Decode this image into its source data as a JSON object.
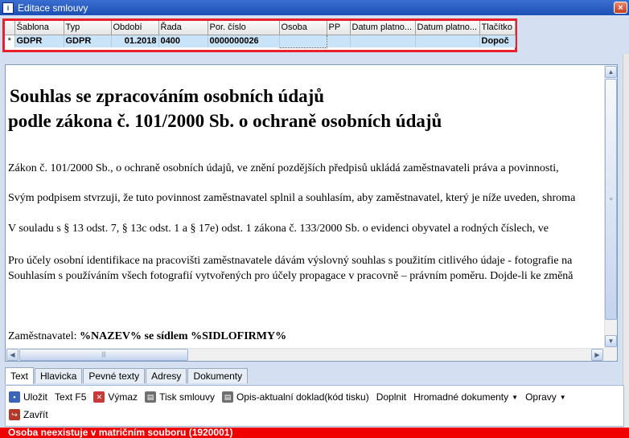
{
  "window": {
    "title": "Editace smlouvy",
    "close": "×"
  },
  "grid": {
    "columns": [
      "Šablona",
      "Typ",
      "Období",
      "Řada",
      "Por. číslo",
      "Osoba",
      "PP",
      "Datum platno...",
      "Datum platno...",
      "Tlačítko"
    ],
    "row": {
      "indicator": "*",
      "sablona": "GDPR",
      "typ": "GDPR",
      "obdobi": "01.2018",
      "rada": "0400",
      "por_cislo": "0000000026",
      "osoba": "",
      "pp": "",
      "datum1": "",
      "datum2": "",
      "tlacitko": "Dopoč"
    }
  },
  "document": {
    "heading1": "Souhlas se zpracováním osobních údajů",
    "heading2": "podle zákona č. 101/2000 Sb. o ochraně osobních údajů",
    "p1": "Zákon č. 101/2000 Sb., o ochraně osobních údajů, ve znění pozdějších předpisů ukládá zaměstnavateli práva a povinnosti,",
    "p2": "Svým podpisem stvrzuji, že tuto povinnost zaměstnavatel splnil a souhlasím, aby zaměstnavatel, který je níže uveden, shroma",
    "p3": "V souladu s § 13 odst. 7, § 13c odst. 1 a § 17e) odst. 1 zákona č. 133/2000 Sb. o evidenci obyvatel a rodných číslech, ve",
    "p4": "Pro účely osobní identifikace na pracovišti zaměstnavatele dávám výslovný souhlas s použitím citlivého údaje - fotografie na",
    "p5": "Souhlasím s používáním všech fotografií vytvořených pro účely propagace v pracovně – právním poměru. Dojde-li ke změnă",
    "employer_label": "Zaměstnavatel: ",
    "employer_value": "%NAZEV% se sídlem %SIDLOFIRMY%"
  },
  "tabs": [
    "Text",
    "Hlavicka",
    "Pevné texty",
    "Adresy",
    "Dokumenty"
  ],
  "toolbar": {
    "ulozit": "Uložit",
    "text_f5": "Text F5",
    "vymaz": "Výmaz",
    "tisk": "Tisk smlouvy",
    "opis": "Opis-aktualní doklad(kód tisku)",
    "doplnit": "Doplnit",
    "hromadne": "Hromadné dokumenty",
    "opravy": "Opravy",
    "zavrit": "Zavřít"
  },
  "status": {
    "message": "Osoba neexistuje v matričním souboru (1920001)"
  },
  "colors": {
    "accent": "#e8202a",
    "status_bg": "#f00000",
    "row_selected": "#c9e3f8"
  }
}
